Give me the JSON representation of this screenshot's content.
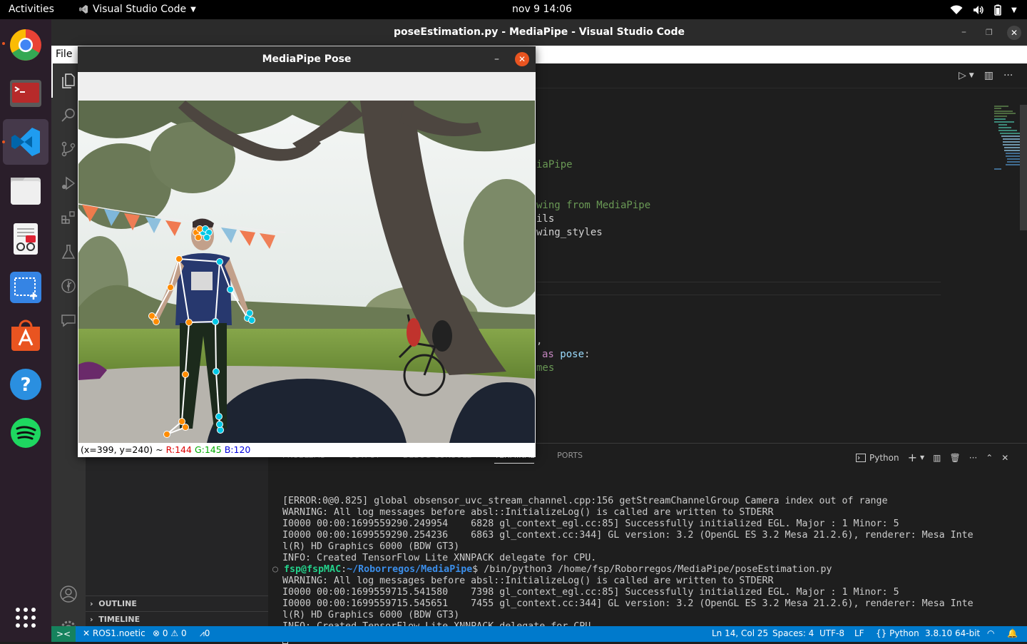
{
  "topbar": {
    "activities": "Activities",
    "app": "Visual Studio Code",
    "clock": "nov 9  14:06"
  },
  "dock": [
    {
      "name": "chrome-icon",
      "color": "#e94235"
    },
    {
      "name": "terminal-icon",
      "color": "#c0392b"
    },
    {
      "name": "vscode-icon",
      "color": "#1f9cf0"
    },
    {
      "name": "files-icon",
      "color": "#e9e9e9"
    },
    {
      "name": "text-editor-icon",
      "color": "#f4f4f4"
    },
    {
      "name": "screenshot-icon",
      "color": "#3584e4"
    },
    {
      "name": "app-center-icon",
      "color": "#e95420"
    },
    {
      "name": "help-icon",
      "color": "#2a8fe0"
    },
    {
      "name": "spotify-icon",
      "color": "#1ed760"
    }
  ],
  "vscode": {
    "title": "poseEstimation.py - MediaPipe - Visual Studio Code",
    "menu_file": "File",
    "sidebar": {
      "outline": "OUTLINE",
      "timeline": "TIMELINE"
    },
    "code": [
      {
        "text": "iaPipe",
        "color": "#6a9955",
        "row": 6
      },
      {
        "text": "wing from MediaPipe",
        "color": "#6a9955",
        "row": 9
      },
      {
        "text": "ils",
        "color": "#d4d4d4",
        "row": 10
      },
      {
        "text": "wing_styles",
        "color": "#d4d4d4",
        "row": 11
      },
      {
        "text": ",",
        "color": "#d4d4d4",
        "row": 19
      },
      {
        "text": "mes",
        "color": "#6a9955",
        "row": 21
      }
    ],
    "code_as_line": {
      "kw": "as",
      "ident": "pose",
      "rest": ":"
    }
  },
  "panel": {
    "tabs": [
      "PROBLEMS",
      "OUTPUT",
      "DEBUG CONSOLE",
      "TERMINAL",
      "PORTS"
    ],
    "active_tab": "TERMINAL",
    "shell": "Python",
    "lines": [
      "[ERROR:0@0.825] global obsensor_uvc_stream_channel.cpp:156 getStreamChannelGroup Camera index out of range",
      "WARNING: All log messages before absl::InitializeLog() is called are written to STDERR",
      "I0000 00:00:1699559290.249954    6828 gl_context_egl.cc:85] Successfully initialized EGL. Major : 1 Minor: 5",
      "I0000 00:00:1699559290.254236    6863 gl_context.cc:344] GL version: 3.2 (OpenGL ES 3.2 Mesa 21.2.6), renderer: Mesa Inte",
      "l(R) HD Graphics 6000 (BDW GT3)",
      "INFO: Created TensorFlow Lite XNNPACK delegate for CPU."
    ],
    "prompt": {
      "user": "fsp@fspMAC",
      "path": "~/Roborregos/MediaPipe",
      "cmd": "$ /bin/python3 /home/fsp/Roborregos/MediaPipe/poseEstimation.py"
    },
    "lines2": [
      "WARNING: All log messages before absl::InitializeLog() is called are written to STDERR",
      "I0000 00:00:1699559715.541580    7398 gl_context_egl.cc:85] Successfully initialized EGL. Major : 1 Minor: 5",
      "I0000 00:00:1699559715.545651    7455 gl_context.cc:344] GL version: 3.2 (OpenGL ES 3.2 Mesa 21.2.6), renderer: Mesa Inte",
      "l(R) HD Graphics 6000 (BDW GT3)",
      "INFO: Created TensorFlow Lite XNNPACK delegate for CPU."
    ]
  },
  "status": {
    "remote": "ROS1.noetic",
    "errors": "0",
    "warnings": "0",
    "ports": "0",
    "cursor": "Ln 14, Col 25",
    "spaces": "Spaces: 4",
    "encoding": "UTF-8",
    "eol": "LF",
    "language": "Python",
    "interpreter": "3.8.10 64-bit"
  },
  "pose_window": {
    "title": "MediaPipe Pose",
    "coords": "(x=399, y=240) ~",
    "r": "R:144",
    "g": "G:145",
    "b": "B:120",
    "colors": {
      "left": "#ff8c00",
      "right": "#00c8e6",
      "line": "#ffffff"
    }
  }
}
